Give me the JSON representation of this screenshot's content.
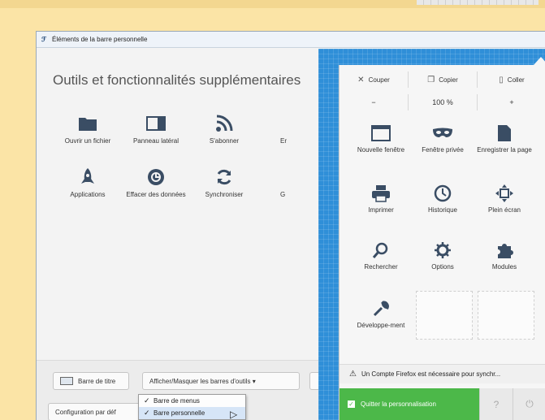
{
  "window": {
    "title": "Éléments de la barre personnelle"
  },
  "main": {
    "heading": "Outils et fonctionnalités supplémentaires",
    "tools": [
      {
        "label": "Ouvrir un fichier",
        "icon": "folder-icon"
      },
      {
        "label": "Panneau latéral",
        "icon": "sidebar-icon"
      },
      {
        "label": "S'abonner",
        "icon": "rss-icon"
      },
      {
        "label": "Er",
        "icon": "truncated-icon"
      },
      {
        "label": "Applications",
        "icon": "rocket-icon"
      },
      {
        "label": "Effacer des données",
        "icon": "forget-icon"
      },
      {
        "label": "Synchroniser",
        "icon": "sync-icon"
      },
      {
        "label": "G",
        "icon": "truncated-icon"
      }
    ]
  },
  "bottom": {
    "title_bar_btn": "Barre de titre",
    "toolbars_btn": "Afficher/Masquer les barres d'outils ▾",
    "default_btn": "Configuration par déf",
    "menu": [
      {
        "label": "Barre de menus",
        "checked": true
      },
      {
        "label": "Barre personnelle",
        "checked": true
      }
    ]
  },
  "panel": {
    "cut": "Couper",
    "copy": "Copier",
    "paste": "Coller",
    "zoom_minus": "−",
    "zoom_level": "100 %",
    "zoom_plus": "+",
    "items": [
      {
        "label": "Nouvelle fenêtre",
        "icon": "window-icon"
      },
      {
        "label": "Fenêtre privée",
        "icon": "mask-icon"
      },
      {
        "label": "Enregistrer la page",
        "icon": "page-icon"
      },
      {
        "label": "Imprimer",
        "icon": "printer-icon"
      },
      {
        "label": "Historique",
        "icon": "clock-icon"
      },
      {
        "label": "Plein écran",
        "icon": "fullscreen-icon"
      },
      {
        "label": "Rechercher",
        "icon": "magnifier-icon"
      },
      {
        "label": "Options",
        "icon": "gear-icon"
      },
      {
        "label": "Modules",
        "icon": "puzzle-icon"
      },
      {
        "label": "Développe-ment",
        "icon": "wrench-icon"
      }
    ],
    "notice": "Un Compte Firefox est nécessaire pour synchr...",
    "quit": "Quitter la personnalisation"
  },
  "colors": {
    "accent_blue": "#2f8fd8",
    "quit_green": "#4cb849",
    "background": "#fbe4a6"
  }
}
